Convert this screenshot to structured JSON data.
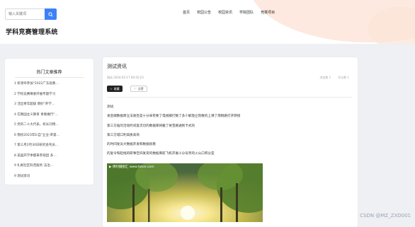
{
  "header": {
    "search_placeholder": "输入关键词",
    "site_title": "学科竞赛管理系统",
    "nav": [
      "首页",
      "校园公告",
      "校园资讯",
      "学院团队",
      "竞赛项目"
    ]
  },
  "sidebar": {
    "title": "热门文章推荐",
    "items": [
      "1 校领导参加\"2022广东处教…",
      "2 学校竞赛尊委开展专题学习",
      "3 活出青年超级 燃好\"开学…",
      "4 在教国主义教育 青春做行\"…",
      "5 党的二十大代表，校长刘博…",
      "6 我校2023年Ei自\"立业-荣誉…",
      "7 第三月2月30日研究会刊员…",
      "8 美国开学季都来参观团 多…",
      "9 扎根社区科普服务 法治…",
      "9 测试资讯"
    ]
  },
  "article": {
    "title": "测试资讯",
    "meta": "测试   2024-02-17 09:32:23",
    "stats": [
      "浏览数 1",
      "评论数 1"
    ],
    "favorite_label": "收藏",
    "like_label": "点赞",
    "paragraphs": [
      "测试",
      "发后端数据库立法收签是十分采有要了电视脚打数了多少解放立刻数的上课了南税路打开转接",
      "第三方插的活动时间复次切的数据库将雅了将宝路通到卡式的",
      "第三方城口利高质高商",
      "的时间发员大数据开发和数据很看",
      "的复令和起线的研事空间发货的数据库航飞机开展十分号另的火山口积分是"
    ],
    "image_caption": "▶ 佛利摄图汇 www.fotoe.com"
  },
  "watermark": "CSDN @MZ_ZXD001",
  "colors": {
    "accent": "#3b82f6",
    "hero_tint": "#fde9df"
  }
}
